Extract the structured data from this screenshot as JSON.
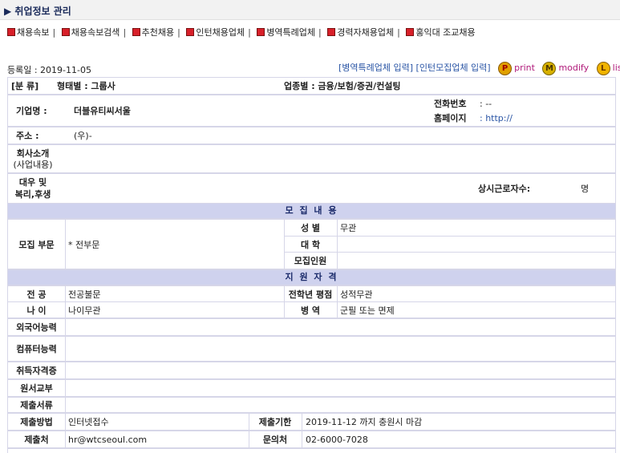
{
  "page_title": "▶ 취업정보 관리",
  "nav": [
    "채용속보",
    "채용속보검색",
    "추천채용",
    "인턴채용업체",
    "병역특례업체",
    "경력자채용업체",
    "홍익대 조교채용"
  ],
  "reg_date": "등록일 : 2019-11-05",
  "actions": {
    "military_input": "[병역특례업체 입력]",
    "intern_input": "[인턴모집업체 입력]",
    "print": "print",
    "modify": "modify",
    "list": "list"
  },
  "info": {
    "category_label": "[분 류]",
    "form_label": "형태별 : 그룹사",
    "industry_label": "업종별 : 금융/보험/증권/컨설팅",
    "company_label": "기업명 :",
    "company_value": "더블유티씨서울",
    "phone_label": "전화번호",
    "phone_value": ": --",
    "homepage_label": "홈페이지",
    "homepage_value": ": http://",
    "address_label": "주소 :",
    "address_value": "(우)-",
    "intro_label_1": "회사소개",
    "intro_label_2": "(사업내용)",
    "welfare_label_1": "대우 및",
    "welfare_label_2": "복리,후생",
    "employees_label": "상시근로자수:",
    "employees_value": "명"
  },
  "recruit": {
    "header": "모 집 내 용",
    "part_label": "모집 부문",
    "part_value": "* 전부문",
    "gender_label": "성 별",
    "gender_value": "무관",
    "school_label": "대 학",
    "school_value": "",
    "count_label": "모집인원",
    "count_value": ""
  },
  "qualify": {
    "header": "지 원 자 격",
    "major_label": "전 공",
    "major_value": "전공불문",
    "gpa_label": "전학년 평점",
    "gpa_value": "성적무관",
    "age_label": "나 이",
    "age_value": "나이무관",
    "military_label": "병 역",
    "military_value": "군필 또는 면제",
    "lang_label": "외국어능력",
    "computer_label": "컴퓨터능력",
    "cert_label": "취득자격증",
    "form_label": "원서교부",
    "docs_label": "제출서류",
    "method_label": "제출방법",
    "method_value": "인터넷접수",
    "deadline_label": "제출기한",
    "deadline_value": "2019-11-12 까지 충원시 마감",
    "place_label": "제출처",
    "place_value": "hr@wtcseoul.com",
    "contact_label": "문의처",
    "contact_value": "02-6000-7028"
  }
}
